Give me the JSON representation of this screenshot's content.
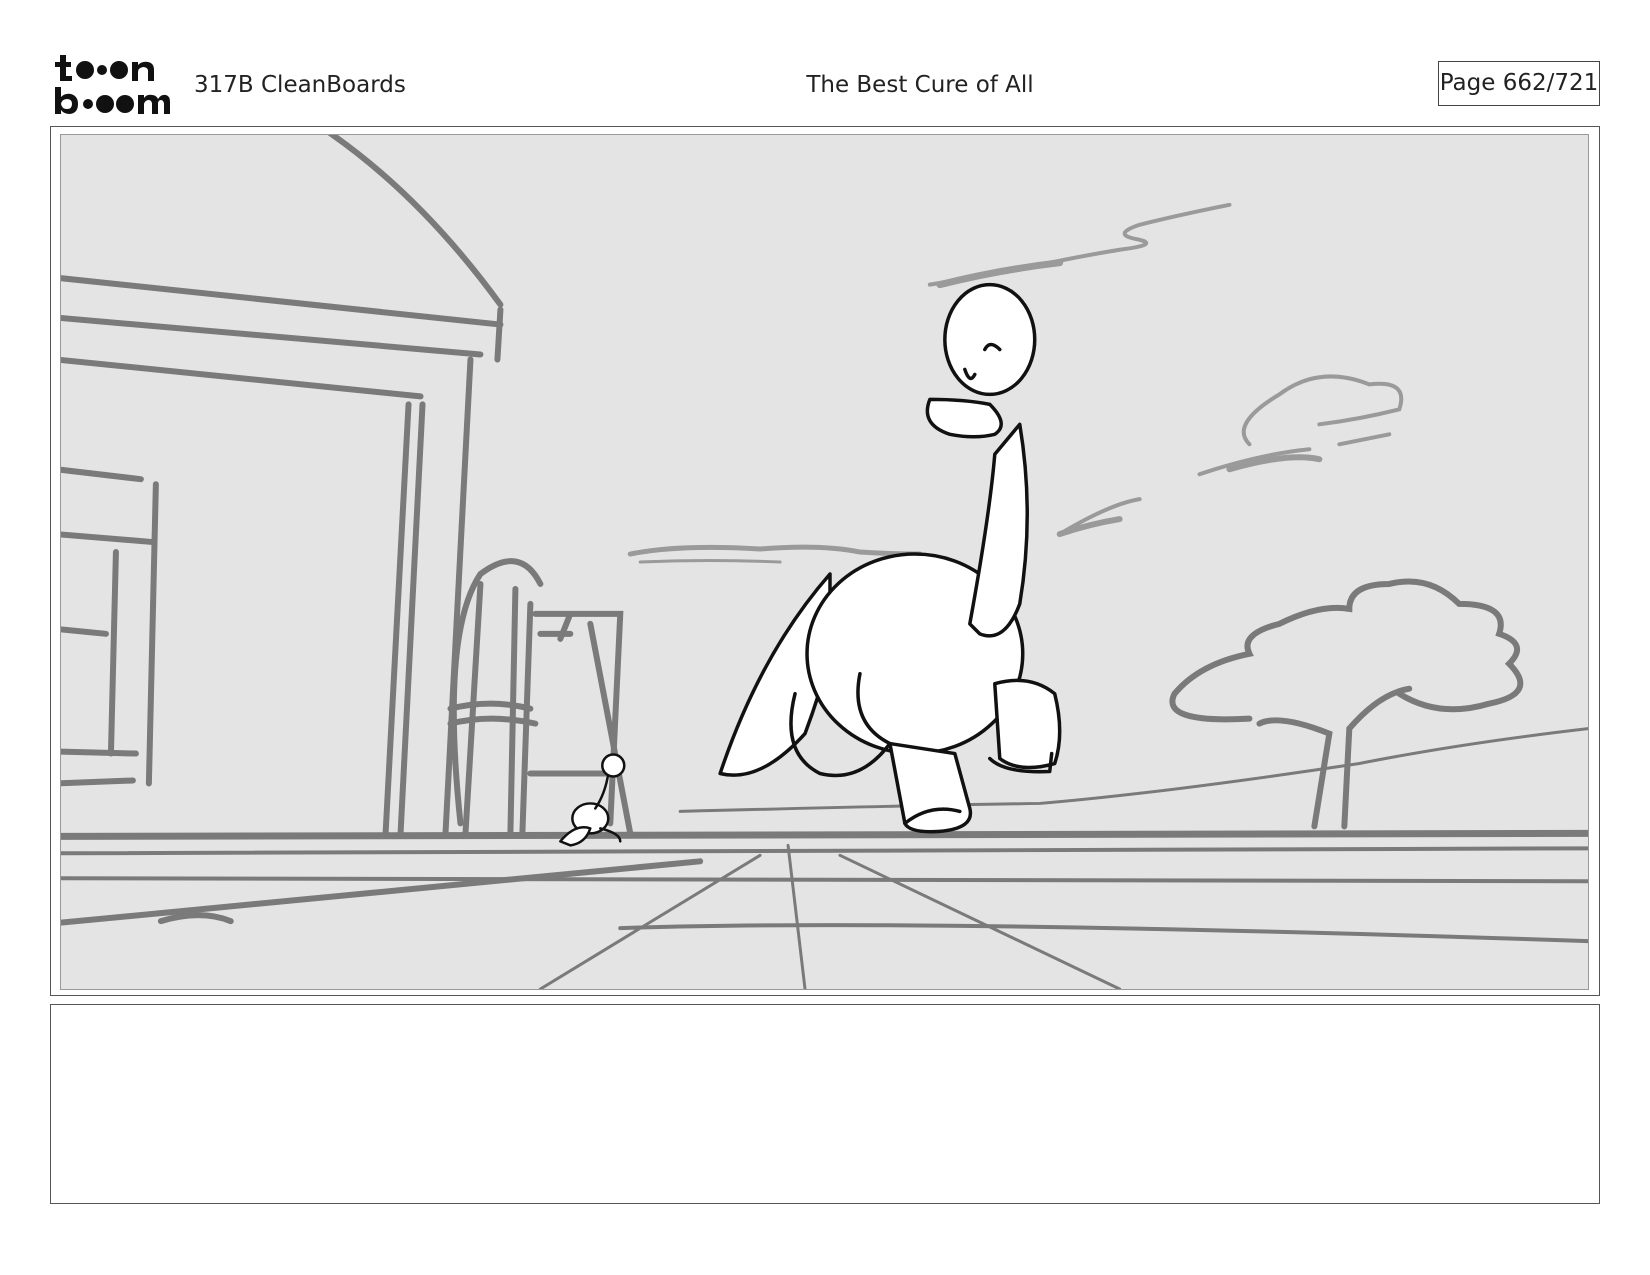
{
  "header": {
    "logo_text": "toon boom",
    "project": "317B  CleanBoards",
    "title": "The Best Cure of All",
    "page": "Page 662/721"
  },
  "panel": {
    "image": "storyboard-sketch"
  },
  "notes": {
    "text": ""
  }
}
